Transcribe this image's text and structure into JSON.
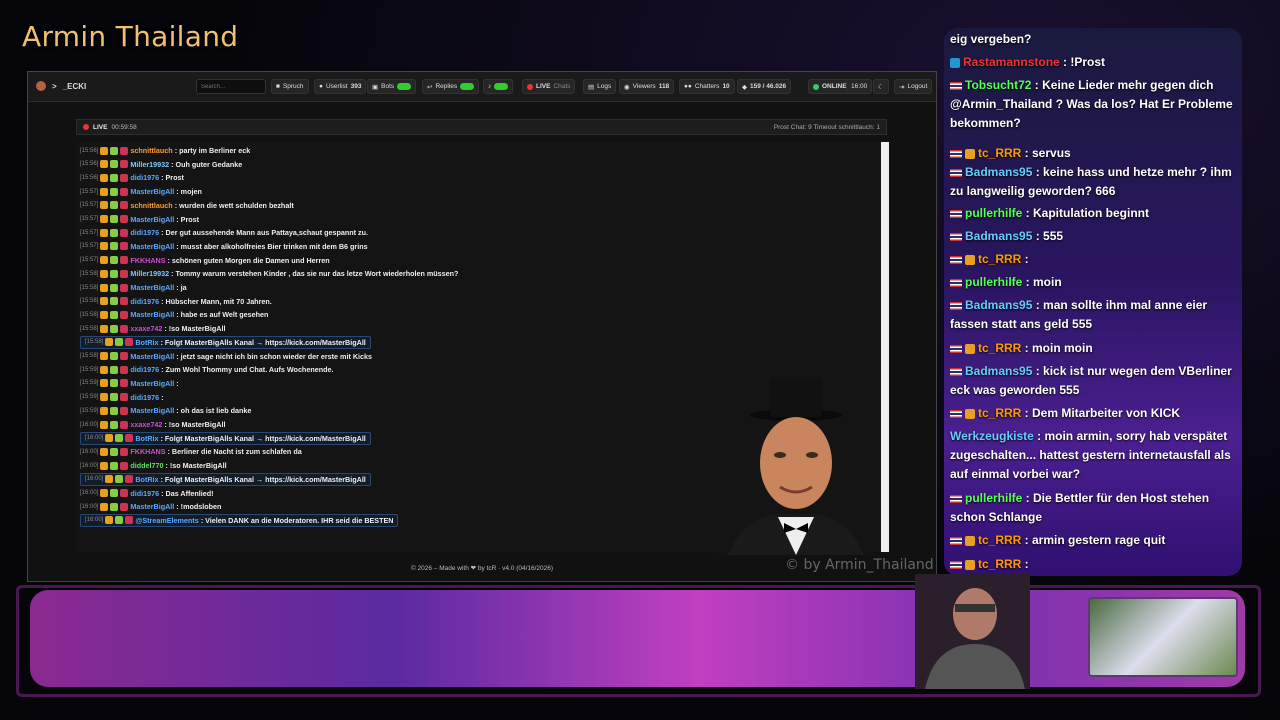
{
  "stream": {
    "title": "Armin Thailand",
    "watermark": "© by Armin_Thailand"
  },
  "app": {
    "brand": "_ECKI",
    "search_placeholder": "Search...",
    "toolbar": {
      "spruch": "Spruch",
      "userlist": "Userlist",
      "userlist_count": "393",
      "bots": "Bots",
      "replies": "Replies",
      "live": "LIVE",
      "chats": "Chats",
      "logs": "Logs",
      "viewers": "Viewers",
      "viewers_count": "118",
      "chatters": "Chatters",
      "chatters_count": "10",
      "messages": "159 / 46.026",
      "online": "ONLINE",
      "value_1600": "16:00",
      "logout": "Logout"
    },
    "livebar": {
      "live": "LIVE",
      "duration": "00:59:58",
      "right": "Prost Chat: 9   Timeout schnittlauch: 1"
    },
    "footer": "© 2026 – Made with ❤ by tcR · v4.0 (04/16/2026)"
  },
  "chat_rows": [
    {
      "ts": "[15:56]",
      "name": "schnittlauch",
      "color": "#ff9933",
      "msg": ": party im Berliner eck"
    },
    {
      "ts": "[15:56]",
      "name": "Miller19932",
      "color": "#7ec8ff",
      "msg": ": Ouh guter Gedanke"
    },
    {
      "ts": "[15:56]",
      "name": "didi1976",
      "color": "#5aa8ff",
      "msg": ": Prost"
    },
    {
      "ts": "[15:57]",
      "name": "MasterBigAll",
      "color": "#5aa8ff",
      "msg": ": mojen"
    },
    {
      "ts": "[15:57]",
      "name": "schnittlauch",
      "color": "#ff9933",
      "msg": ": wurden die wett schulden bezhalt"
    },
    {
      "ts": "[15:57]",
      "name": "MasterBigAll",
      "color": "#5aa8ff",
      "msg": ": Prost"
    },
    {
      "ts": "[15:57]",
      "name": "didi1976",
      "color": "#5aa8ff",
      "msg": ": Der gut aussehende Mann aus Pattaya,schaut gespannt zu."
    },
    {
      "ts": "[15:57]",
      "name": "MasterBigAll",
      "color": "#5aa8ff",
      "msg": ": musst aber alkoholfreies Bier trinken mit dem B6 grins"
    },
    {
      "ts": "[15:57]",
      "name": "FKKHANS",
      "color": "#d050d0",
      "msg": ": schönen guten Morgen die Damen und Herren"
    },
    {
      "ts": "[15:58]",
      "name": "Miller19932",
      "color": "#7ec8ff",
      "msg": ": Tommy warum verstehen Kinder , das sie nur das letze Wort wiederholen müssen?"
    },
    {
      "ts": "[15:58]",
      "name": "MasterBigAll",
      "color": "#5aa8ff",
      "msg": ": ja"
    },
    {
      "ts": "[15:58]",
      "name": "didi1976",
      "color": "#5aa8ff",
      "msg": ": Hübscher Mann, mit 70 Jahren."
    },
    {
      "ts": "[15:58]",
      "name": "MasterBigAll",
      "color": "#5aa8ff",
      "msg": ": habe es auf Welt gesehen"
    },
    {
      "ts": "[15:58]",
      "name": "xxaxe742",
      "color": "#c050e0",
      "msg": ": !so MasterBigAll"
    },
    {
      "ts": "[15:58]",
      "name": "BotRix",
      "color": "#5aa8ff",
      "msg": ": Folgt MasterBigAlls Kanal → https://kick.com/MasterBigAll",
      "box": true
    },
    {
      "ts": "[15:58]",
      "name": "MasterBigAll",
      "color": "#5aa8ff",
      "msg": ": jetzt sage nicht ich bin schon wieder der erste mit Kicks"
    },
    {
      "ts": "[15:59]",
      "name": "didi1976",
      "color": "#5aa8ff",
      "msg": ": Zum Wohl Thommy und Chat. Aufs Wochenende."
    },
    {
      "ts": "[15:59]",
      "name": "MasterBigAll",
      "color": "#5aa8ff",
      "msg": ":"
    },
    {
      "ts": "[15:59]",
      "name": "didi1976",
      "color": "#5aa8ff",
      "msg": ":"
    },
    {
      "ts": "[15:59]",
      "name": "MasterBigAll",
      "color": "#5aa8ff",
      "msg": ": oh das ist lieb danke"
    },
    {
      "ts": "[16:00]",
      "name": "xxaxe742",
      "color": "#c050e0",
      "msg": ": !so MasterBigAll"
    },
    {
      "ts": "[16:00]",
      "name": "BotRix",
      "color": "#5aa8ff",
      "msg": ": Folgt MasterBigAlls Kanal → https://kick.com/MasterBigAll",
      "box": true
    },
    {
      "ts": "[16:00]",
      "name": "FKKHANS",
      "color": "#d050d0",
      "msg": ": Berliner die Nacht ist zum schlafen da"
    },
    {
      "ts": "[16:00]",
      "name": "diddel770",
      "color": "#5fdc5f",
      "msg": ": !so MasterBigAll"
    },
    {
      "ts": "[16:00]",
      "name": "BotRix",
      "color": "#5aa8ff",
      "msg": ": Folgt MasterBigAlls Kanal → https://kick.com/MasterBigAll",
      "box": true
    },
    {
      "ts": "[16:00]",
      "name": "didi1976",
      "color": "#5aa8ff",
      "msg": ": Das Affenlied!"
    },
    {
      "ts": "[16:00]",
      "name": "MasterBigAll",
      "color": "#5aa8ff",
      "msg": ": !modsloben"
    },
    {
      "ts": "[16:00]",
      "name": "@StreamElements",
      "color": "#5aa8ff",
      "msg": ": Vielen DANK an die Moderatoren. IHR seid die BESTEN",
      "box": true
    }
  ],
  "overlay": [
    {
      "name": "",
      "msg": "eig vergeben?"
    },
    {
      "name": "Rastamannstone",
      "msg": " : !Prost",
      "ucls": "u-red",
      "badge": "bblue"
    },
    {
      "name": "Tobsucht72",
      "msg": " : Keine Lieder mehr gegen dich @Armin_Thailand ? Was da los? Hat Er Probleme bekommen?",
      "ucls": "u-grn2",
      "flag": true
    },
    {
      "name": "tc_RRR",
      "msg": " : servus",
      "ucls": "u-orange",
      "flag": true,
      "badge": "y"
    },
    {
      "name": "Badmans95",
      "msg": " : keine hass und hetze mehr ? ihm zu langweilig geworden? 666",
      "ucls": "u-cyan",
      "flag": true
    },
    {
      "name": "pullerhilfe",
      "msg": " : Kapitulation beginnt",
      "ucls": "u-grn2",
      "flag": true
    },
    {
      "name": "Badmans95",
      "msg": " : 555",
      "ucls": "u-cyan",
      "flag": true
    },
    {
      "name": "tc_RRR",
      "msg": " :",
      "ucls": "u-orange",
      "flag": true,
      "badge": "y"
    },
    {
      "name": "pullerhilfe",
      "msg": " : moin",
      "ucls": "u-grn2",
      "flag": true
    },
    {
      "name": "Badmans95",
      "msg": " : man sollte ihm mal anne eier fassen statt ans geld 555",
      "ucls": "u-cyan",
      "flag": true
    },
    {
      "name": "tc_RRR",
      "msg": " : moin moin",
      "ucls": "u-orange",
      "flag": true,
      "badge": "y"
    },
    {
      "name": "Badmans95",
      "msg": " : kick ist nur wegen dem VBerliner eck was geworden 555",
      "ucls": "u-cyan",
      "flag": true
    },
    {
      "name": "tc_RRR",
      "msg": " : Dem Mitarbeiter von KICK",
      "ucls": "u-orange",
      "flag": true,
      "badge": "y"
    },
    {
      "name": "Werkzeugkiste",
      "msg": " : moin armin, sorry hab verspätet zugeschalten... hattest gestern internetausfall als auf einmal vorbei war?",
      "ucls": "u-cyan"
    },
    {
      "name": "pullerhilfe",
      "msg": " : Die Bettler für den Host stehen schon Schlange",
      "ucls": "u-grn2",
      "flag": true
    },
    {
      "name": "tc_RRR",
      "msg": " : armin gestern rage quit",
      "ucls": "u-orange",
      "flag": true,
      "badge": "y"
    },
    {
      "name": "tc_RRR",
      "msg": " :",
      "ucls": "u-orange",
      "flag": true,
      "badge": "y"
    }
  ]
}
